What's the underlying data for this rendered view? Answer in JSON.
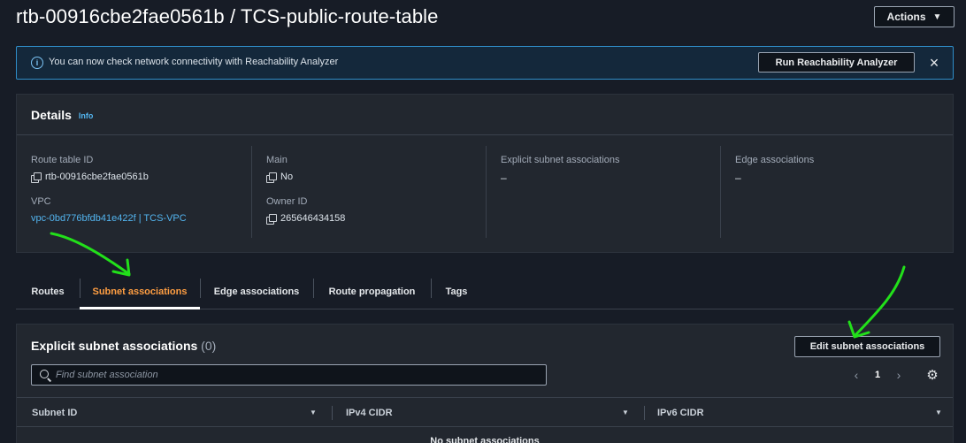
{
  "page": {
    "title": "rtb-00916cbe2fae0561b / TCS-public-route-table",
    "actions_label": "Actions"
  },
  "banner": {
    "icon": "info-icon",
    "text": "You can now check network connectivity with Reachability Analyzer",
    "run_label": "Run Reachability Analyzer",
    "close_icon": "×"
  },
  "details": {
    "title": "Details",
    "info_link": "Info",
    "route_table_id_label": "Route table ID",
    "route_table_id": "rtb-00916cbe2fae0561b",
    "vpc_label": "VPC",
    "vpc_value": "vpc-0bd776bfdb41e422f | TCS-VPC",
    "main_label": "Main",
    "main_value": "No",
    "owner_label": "Owner ID",
    "owner_value": "265646434158",
    "explicit_label": "Explicit subnet associations",
    "explicit_value": "–",
    "edge_label": "Edge associations",
    "edge_value": "–"
  },
  "tabs": [
    {
      "label": "Routes",
      "active": false
    },
    {
      "label": "Subnet associations",
      "active": true
    },
    {
      "label": "Edge associations",
      "active": false
    },
    {
      "label": "Route propagation",
      "active": false
    },
    {
      "label": "Tags",
      "active": false
    }
  ],
  "subnets": {
    "title": "Explicit subnet associations",
    "count": "(0)",
    "edit_label": "Edit subnet associations",
    "search_placeholder": "Find subnet association",
    "page_number": "1",
    "columns": [
      "Subnet ID",
      "IPv4 CIDR",
      "IPv6 CIDR"
    ],
    "empty_text": "No subnet associations"
  },
  "colors": {
    "accent_tab": "#ff9e42",
    "link": "#53b5f0",
    "annotation": "#22e01a"
  }
}
